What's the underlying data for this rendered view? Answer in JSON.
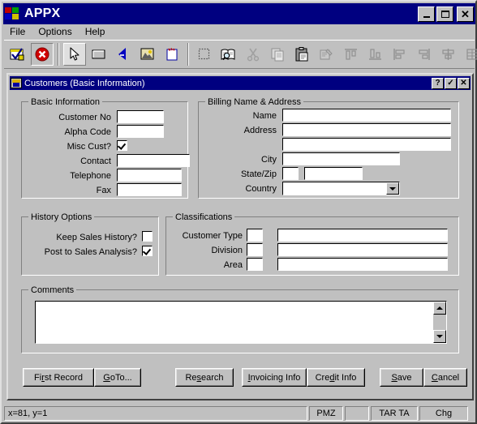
{
  "app": {
    "title": "APPX",
    "logo_icon": "windows-logo-icon",
    "caption_buttons": [
      {
        "name": "minimize-button",
        "label": "_"
      },
      {
        "name": "maximize-button",
        "label": "□"
      },
      {
        "name": "close-button",
        "label": "✕"
      }
    ],
    "menu": [
      {
        "label": "File",
        "name": "menu-file"
      },
      {
        "label": "Options",
        "name": "menu-options"
      },
      {
        "label": "Help",
        "name": "menu-help"
      }
    ]
  },
  "toolbar": {
    "groups": [
      {
        "buttons": [
          {
            "name": "validate-icon",
            "state": "enabled"
          },
          {
            "name": "cancel-icon",
            "state": "pressed"
          }
        ]
      },
      {
        "buttons": [
          {
            "name": "pointer-icon",
            "state": "selected"
          },
          {
            "name": "button-widget-icon",
            "state": "enabled"
          },
          {
            "name": "text-widget-icon",
            "state": "enabled"
          },
          {
            "name": "image-widget-icon",
            "state": "enabled"
          },
          {
            "name": "new-widget-icon",
            "state": "enabled"
          }
        ]
      },
      {
        "buttons": [
          {
            "name": "select-all-icon",
            "state": "disabled"
          },
          {
            "name": "find-icon",
            "state": "enabled"
          },
          {
            "name": "cut-icon",
            "state": "disabled"
          },
          {
            "name": "copy-icon",
            "state": "disabled"
          },
          {
            "name": "paste-icon",
            "state": "enabled"
          },
          {
            "name": "properties-icon",
            "state": "disabled"
          },
          {
            "name": "align-top-icon",
            "state": "disabled"
          },
          {
            "name": "align-bottom-icon",
            "state": "disabled"
          },
          {
            "name": "align-left-icon",
            "state": "disabled"
          },
          {
            "name": "align-right-icon",
            "state": "disabled"
          },
          {
            "name": "align-center-icon",
            "state": "disabled"
          },
          {
            "name": "distribute-icon",
            "state": "disabled"
          }
        ]
      }
    ]
  },
  "form": {
    "title": "Customers (Basic Information)",
    "icon": "form-window-icon",
    "caption_buttons": [
      {
        "name": "help-button",
        "label": "?"
      },
      {
        "name": "ok-button",
        "label": "✓"
      },
      {
        "name": "close-button",
        "label": "✕"
      }
    ],
    "basic_information": {
      "legend": "Basic Information",
      "fields": [
        {
          "label": "Customer No",
          "value": "",
          "name": "customer-no-field"
        },
        {
          "label": "Alpha Code",
          "value": "",
          "name": "alpha-code-field"
        },
        {
          "label": "Misc Cust?",
          "value": "",
          "name": "misc-cust-checkbox",
          "checked": true
        },
        {
          "label": "Contact",
          "value": "",
          "name": "contact-field"
        },
        {
          "label": "Telephone",
          "value": "",
          "name": "telephone-field"
        },
        {
          "label": "Fax",
          "value": "",
          "name": "fax-field"
        }
      ]
    },
    "billing": {
      "legend": "Billing Name & Address",
      "fields": [
        {
          "label": "Name",
          "value": "",
          "name": "billing-name-field"
        },
        {
          "label": "Address",
          "value": "",
          "name": "billing-address1-field"
        },
        {
          "label": "",
          "value": "",
          "name": "billing-address2-field"
        },
        {
          "label": "City",
          "value": "",
          "name": "billing-city-field"
        },
        {
          "label": "State/Zip",
          "value": "",
          "name": "billing-state-field"
        },
        {
          "label": "",
          "value": "",
          "name": "billing-zip-field"
        },
        {
          "label": "Country",
          "value": "",
          "name": "billing-country-combo"
        }
      ]
    },
    "history_options": {
      "legend": "History Options",
      "items": [
        {
          "label": "Keep Sales History?",
          "checked": false,
          "name": "keep-sales-history-checkbox"
        },
        {
          "label": "Post to Sales Analysis?",
          "checked": true,
          "name": "post-to-sales-analysis-checkbox"
        }
      ]
    },
    "classifications": {
      "legend": "Classifications",
      "rows": [
        {
          "label": "Customer Type",
          "code": "",
          "desc": "",
          "name": "customer-type"
        },
        {
          "label": "Division",
          "code": "",
          "desc": "",
          "name": "division"
        },
        {
          "label": "Area",
          "code": "",
          "desc": "",
          "name": "area"
        }
      ]
    },
    "comments": {
      "legend": "Comments",
      "value": ""
    },
    "buttons": [
      {
        "label": "First Record",
        "accel": "s",
        "name": "first-record-button"
      },
      {
        "label": "GoTo...",
        "accel": "G",
        "name": "goto-button"
      },
      {
        "label": "Research",
        "accel": "s",
        "name": "research-button"
      },
      {
        "label": "Invoicing Info",
        "accel": "I",
        "name": "invoicing-info-button"
      },
      {
        "label": "Credit Info",
        "accel": "d",
        "name": "credit-info-button"
      },
      {
        "label": "Save",
        "accel": "S",
        "name": "save-button"
      },
      {
        "label": "Cancel",
        "accel": "C",
        "name": "cancel-button"
      }
    ]
  },
  "statusbar": {
    "coords": "x=81, y=1",
    "panel_mode": "PMZ",
    "panel_blank": "",
    "panel_target": "TAR TA",
    "panel_change": "Chg"
  },
  "colors": {
    "titlebar": "#000080",
    "face": "#c0c0c0",
    "field": "#ffffff",
    "shadow": "#808080"
  }
}
